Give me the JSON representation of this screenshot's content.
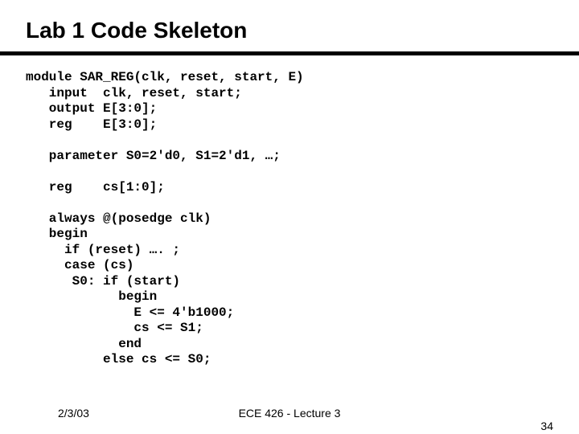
{
  "title": "Lab 1 Code Skeleton",
  "code": {
    "l1": "module SAR_REG(clk, reset, start, E)",
    "l2": "   input  clk, reset, start;",
    "l3": "   output E[3:0];",
    "l4": "   reg    E[3:0];",
    "l5": "",
    "l6": "   parameter S0=2'd0, S1=2'd1, …;",
    "l7": "",
    "l8": "   reg    cs[1:0];",
    "l9": "",
    "l10": "   always @(posedge clk)",
    "l11": "   begin",
    "l12": "     if (reset) …. ;",
    "l13": "     case (cs)",
    "l14": "      S0: if (start)",
    "l15": "            begin",
    "l16": "              E <= 4'b1000;",
    "l17": "              cs <= S1;",
    "l18": "            end",
    "l19": "          else cs <= S0;"
  },
  "footer": {
    "date": "2/3/03",
    "center": "ECE 426 - Lecture 3",
    "page": "34"
  }
}
